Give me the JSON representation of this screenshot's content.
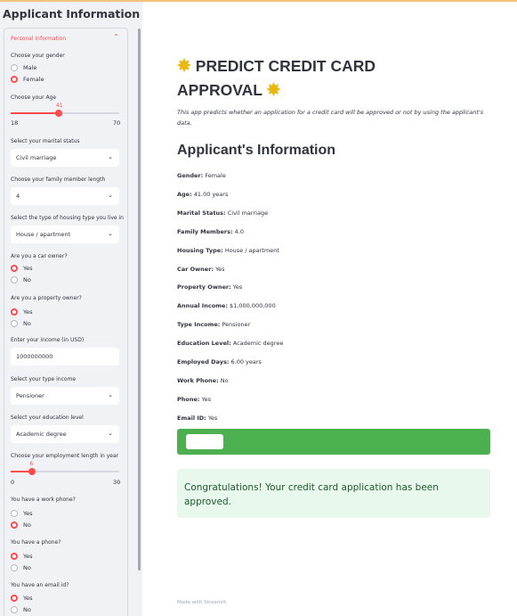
{
  "sidebar": {
    "title": "Applicant Information",
    "panel_header": "Personal Information",
    "gender": {
      "label": "Choose your gender",
      "options": [
        "Male",
        "Female"
      ],
      "selected": "Female"
    },
    "age": {
      "label": "Choose your Age",
      "value": "41",
      "min": "18",
      "max": "70",
      "fraction": 0.442
    },
    "marital": {
      "label": "Select your marital status",
      "value": "Civil marriage"
    },
    "family": {
      "label": "Choose your family member length",
      "value": "4"
    },
    "housing": {
      "label": "Select the type of housing type you live in",
      "value": "House / apartment"
    },
    "car": {
      "label": "Are you a car owner?",
      "options": [
        "Yes",
        "No"
      ],
      "selected": "Yes"
    },
    "property": {
      "label": "Are you a property owner?",
      "options": [
        "Yes",
        "No"
      ],
      "selected": "Yes"
    },
    "income": {
      "label": "Enter your income (in USD)",
      "value": "1000000000"
    },
    "income_type": {
      "label": "Select your type income",
      "value": "Pensioner"
    },
    "education": {
      "label": "Select your education level",
      "value": "Academic degree"
    },
    "employment": {
      "label": "Choose your employment length in year",
      "value": "6",
      "min": "0",
      "max": "30",
      "fraction": 0.2
    },
    "work_phone": {
      "label": "You have a work phone?",
      "options": [
        "Yes",
        "No"
      ],
      "selected": "No"
    },
    "phone": {
      "label": "You have a phone?",
      "options": [
        "Yes",
        "No"
      ],
      "selected": "Yes"
    },
    "email": {
      "label": "You have an email id?",
      "options": [
        "Yes",
        "No"
      ],
      "selected": "Yes"
    }
  },
  "main": {
    "title_line1": "PREDICT CREDIT CARD",
    "title_line2": "APPROVAL",
    "star_icon": "✸",
    "subtitle": "This app predicts whether an application for a credit card will be approved or not by using the applicant's data.",
    "info_heading": "Applicant's Information",
    "info": [
      {
        "key": "Gender:",
        "value": "Female"
      },
      {
        "key": "Age:",
        "value": "41.00 years"
      },
      {
        "key": "Marital Status:",
        "value": "Civil marriage"
      },
      {
        "key": "Family Members:",
        "value": "4.0"
      },
      {
        "key": "Housing Type:",
        "value": "House / apartment"
      },
      {
        "key": "Car Owner:",
        "value": "Yes"
      },
      {
        "key": "Property Owner:",
        "value": "Yes"
      },
      {
        "key": "Annual Income:",
        "value": "$1,000,000,000"
      },
      {
        "key": "Type Income:",
        "value": "Pensioner"
      },
      {
        "key": "Education Level:",
        "value": "Academic degree"
      },
      {
        "key": "Employed Days:",
        "value": "6.00 years"
      },
      {
        "key": "Work Phone:",
        "value": "No"
      },
      {
        "key": "Phone:",
        "value": "Yes"
      },
      {
        "key": "Email ID:",
        "value": "Yes"
      }
    ],
    "success_message": "Congratulations! Your credit card application has been approved.",
    "footer": "Made with Streamlit"
  },
  "colors": {
    "accent": "#ff4b4b",
    "success_bar": "#4caf50",
    "success_bg": "#e8f8ec",
    "sidebar_bg": "#f0f2f6"
  }
}
